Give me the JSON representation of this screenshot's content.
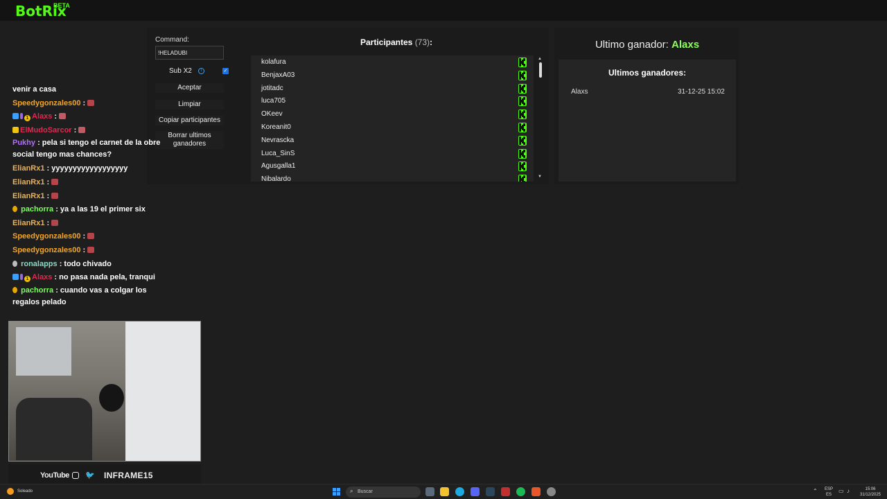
{
  "app": {
    "name": "BotRix",
    "badge": "BETA"
  },
  "command": {
    "label": "Command:",
    "value": "!HELADUBI"
  },
  "sub": {
    "label": "Sub X2",
    "checked": true
  },
  "buttons": {
    "accept": "Aceptar",
    "clear": "Limpiar",
    "copy": "Copiar participantes",
    "delete_line1": "Borrar ultimos",
    "delete_line2": "ganadores"
  },
  "participants": {
    "title": "Participantes",
    "count": "(73)",
    "colon": ":",
    "items": [
      "kolafura",
      "BenjaxA03",
      "jotitadc",
      "luca705",
      "OKeev",
      "Koreanit0",
      "Nevrascka",
      "Luca_SinS",
      "Agusgalla1",
      "Nibalardo"
    ]
  },
  "winner": {
    "label": "Ultimo ganador:",
    "name": "Alaxs",
    "history_title": "Ultimos ganadores:",
    "history": [
      {
        "name": "Alaxs",
        "date": "31-12-25 15:02"
      }
    ]
  },
  "chat": [
    {
      "user": "",
      "text": "venir a casa"
    },
    {
      "user": "Speedygonzales00",
      "text": ""
    },
    {
      "user": "Alaxs",
      "text": ""
    },
    {
      "user": "ElMudoSarcor",
      "text": ""
    },
    {
      "user": "Pukhy",
      "text": "pela si tengo el carnet de la obre social tengo mas chances?"
    },
    {
      "user": "ElianRx1",
      "text": "yyyyyyyyyyyyyyyyyy"
    },
    {
      "user": "ElianRx1",
      "text": ""
    },
    {
      "user": "ElianRx1",
      "text": ""
    },
    {
      "user": "pachorra",
      "text": "ya a las 19 el primer six"
    },
    {
      "user": "ElianRx1",
      "text": ""
    },
    {
      "user": "Speedygonzales00",
      "text": ""
    },
    {
      "user": "Speedygonzales00",
      "text": ""
    },
    {
      "user": "ronalapps",
      "text": "todo chivado"
    },
    {
      "user": "Alaxs",
      "text": "no pasa nada pela, tranqui"
    },
    {
      "user": "pachorra",
      "text": "cuando vas a colgar los regalos pelado"
    }
  ],
  "social": {
    "youtube": "YouTube",
    "handle": "INFRAME15"
  },
  "taskbar": {
    "weather": "Soleado",
    "search": "Buscar",
    "lang1": "ESP",
    "lang2": "ES",
    "time": "15:06",
    "date": "31/12/2025"
  },
  "colors": {
    "kick_green": "#53fc18",
    "winner_green": "#8cff5a",
    "background": "#1e1e1e"
  }
}
